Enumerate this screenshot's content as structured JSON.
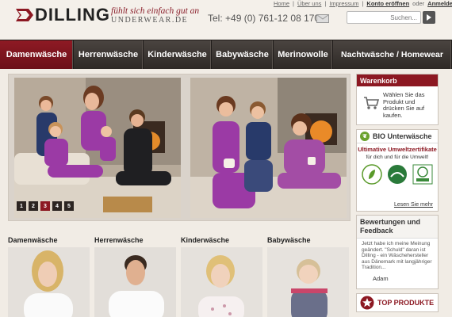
{
  "header": {
    "logo": "DILLING",
    "tagline_top": "fühlt sich einfach gut an",
    "tagline_bottom": "UNDERWEAR.DE",
    "phone": "Tel: +49 (0) 761-12 08 170",
    "top_links": [
      "Home",
      "Über uns",
      "Impressum"
    ],
    "account_link": "Konto eröffnen",
    "or": "oder",
    "login_link": "Anmelden",
    "search_placeholder": "Suchen..."
  },
  "nav": {
    "items": [
      "Damenwäsche",
      "Herrenwäsche",
      "Kinderwäsche",
      "Babywäsche",
      "Merinowolle",
      "Nachtwäsche / Homewear"
    ],
    "active": 0
  },
  "slider": {
    "dots": [
      "1",
      "2",
      "3",
      "4",
      "5"
    ],
    "active_dot": 2
  },
  "cart": {
    "title": "Warenkorb",
    "text": "Wählen Sie das Produkt und drücken Sie auf kaufen."
  },
  "bio": {
    "title": "BIO Unterwäsche",
    "headline": "Ultimative Umweltzertifikate",
    "subline": "für dich und für die Umwelt!",
    "more": "Lesen Sie mehr"
  },
  "reviews": {
    "title": "Bewertungen und Feedback",
    "text": "Jetzt habe ich meine Meinung geändert. \"Schuld\" daran ist Dilling - ein Wäschehersteller aus Dänemark mit langjähriger Tradition...",
    "author": "Adam"
  },
  "top_products": {
    "label": "TOP PRODUKTE"
  },
  "categories": [
    "Damenwäsche",
    "Herrenwäsche",
    "Kinderwäsche",
    "Babywäsche"
  ],
  "colors": {
    "brand_red": "#8c1822",
    "nav_dark": "#2e2926",
    "purple": "#9b3aa5"
  }
}
